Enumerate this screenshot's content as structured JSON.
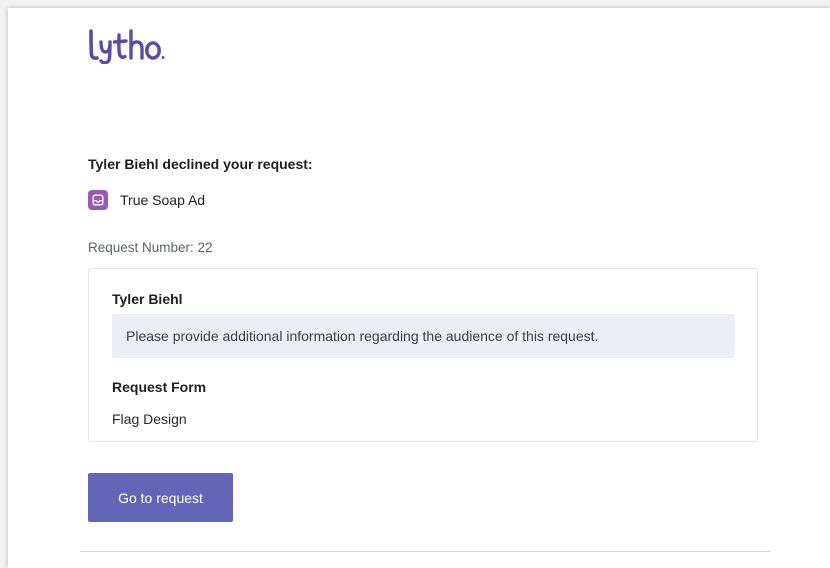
{
  "brand": {
    "logo_text": "Lytho",
    "color": "#5b4ba3"
  },
  "email": {
    "headline": "Tyler Biehl declined your request:",
    "item": {
      "name": "True Soap Ad",
      "icon": "inbox-tray-icon",
      "icon_color": "#9b59b6"
    },
    "request_number": "Request Number: 22",
    "card": {
      "user": "Tyler Biehl",
      "comment": "Please provide additional information regarding the audience of this request.",
      "form_label": "Request Form",
      "form_value": "Flag Design"
    },
    "button_label": "Go to request",
    "button_color": "#6366b7"
  }
}
